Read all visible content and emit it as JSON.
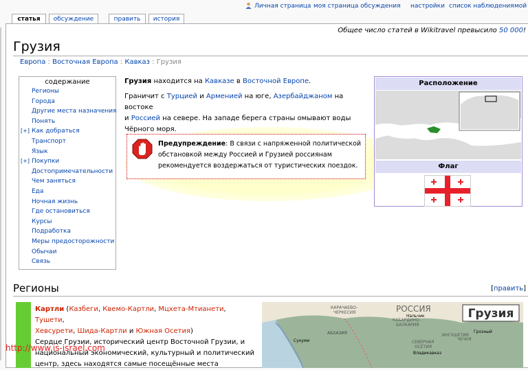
{
  "personal": {
    "user_page": "Личная страница",
    "user_talk": "моя страница обсуждения",
    "prefs": "настройки",
    "watchlist": "список наблюдения",
    "mine": "мой"
  },
  "tabs": [
    {
      "label": "статья"
    },
    {
      "label": "обсуждение"
    },
    {
      "label": "править"
    },
    {
      "label": "история"
    }
  ],
  "sitenotice": {
    "prefix": "Общее число статей в Wikitravel превысило ",
    "count": "50 000",
    "suffix": "!"
  },
  "title": "Грузия",
  "breadcrumb": {
    "p1": "Европа",
    "p2": "Восточная Европа",
    "p3": "Кавказ",
    "current": "Грузия",
    "sep": " : "
  },
  "toc": {
    "heading": "содержание",
    "items": [
      {
        "label": "Регионы",
        "plus": ""
      },
      {
        "label": "Города",
        "plus": ""
      },
      {
        "label": "Другие места назначения",
        "plus": ""
      },
      {
        "label": "Понять",
        "plus": ""
      },
      {
        "label": "Как добраться",
        "plus": "[+]"
      },
      {
        "label": "Транспорт",
        "plus": ""
      },
      {
        "label": "Язык",
        "plus": ""
      },
      {
        "label": "Покупки",
        "plus": "[+]"
      },
      {
        "label": "Достопримечательности",
        "plus": ""
      },
      {
        "label": "Чем заняться",
        "plus": ""
      },
      {
        "label": "Еда",
        "plus": ""
      },
      {
        "label": "Ночная жизнь",
        "plus": ""
      },
      {
        "label": "Где остановиться",
        "plus": ""
      },
      {
        "label": "Курсы",
        "plus": ""
      },
      {
        "label": "Подработка",
        "plus": ""
      },
      {
        "label": "Меры предосторожности",
        "plus": ""
      },
      {
        "label": "Обычаи",
        "plus": ""
      },
      {
        "label": "Связь",
        "plus": ""
      }
    ]
  },
  "intro": {
    "bold": "Грузия",
    "t1": " находится на ",
    "l1": "Кавказе",
    "t2": " в ",
    "l2": "Восточной Европе",
    "t3": "."
  },
  "border": {
    "t1": "Граничит с ",
    "l1": "Турцией",
    "t2": " и ",
    "l2": "Арменией",
    "t3": " на юге, ",
    "l3": "Азербайджаном",
    "t4": " на востоке",
    "t5": "и ",
    "l4": "Россией",
    "t6": " на севере. На западе берега страны омывают воды",
    "t7": "Чёрного моря."
  },
  "warning": {
    "bold": "Предупреждение",
    "line1": ": В связи с напряженной политической",
    "line2": "обстановкой между Россией и Грузией россиянам",
    "line3": "рекомендуется воздержаться от туристических поездок."
  },
  "infobox": {
    "location": "Расположение",
    "flag": "Флаг"
  },
  "regions": {
    "heading": "Регионы",
    "edit_label": "править",
    "name": "Картли",
    "subs": [
      "Казбеги",
      "Квемо-Картли",
      "Мцхета-Мтианети",
      "Тушети",
      "Хевсурети",
      "Шида-Картли",
      "Южная Осетия"
    ],
    "desc1": "Сердце Грузии, исторический центр Восточной Грузии, и",
    "desc2": "национальный экономический, культурный и политический",
    "desc3": "центр, здесь находятся самые посещённые места"
  },
  "regionmap": {
    "title": "Грузия",
    "labels": [
      "КАРАЧАЕВО-",
      "ЧЕРКЕСИЯ",
      "РОССИЯ",
      "КАБАРДИНО-",
      "БАЛКАРИЯ",
      "СЕВЕРНАЯ",
      "ОСЕТИЯ",
      "ИНГУШЕТИЯ",
      "ЧЕЧНЯ",
      "АБХАЗИЯ",
      "Сухуми",
      "Грозный",
      "Нальчик",
      "Владикавказ"
    ]
  },
  "watermark": "http://www.is-israel.com",
  "colors": {
    "link": "#0645ad",
    "warn_border": "#cc0000",
    "infobox_border": "#a28cd6",
    "region_bar": "#66cc33",
    "watermark": "#e32020"
  }
}
